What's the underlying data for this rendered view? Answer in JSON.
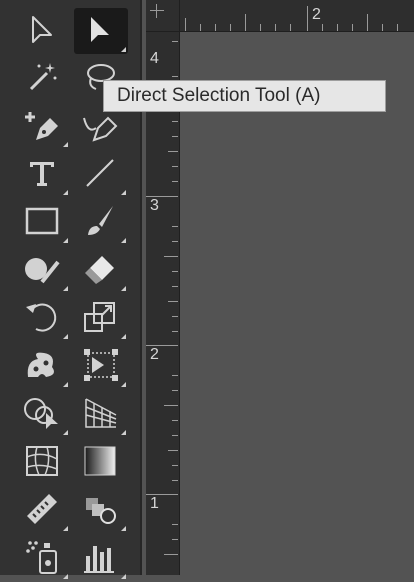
{
  "tooltip": {
    "text": "Direct Selection Tool (A)"
  },
  "ruler": {
    "top_label": "2",
    "left_labels": [
      "4",
      "3",
      "2",
      "1"
    ]
  },
  "colors": {
    "toolbar_bg": "#323232",
    "canvas_bg": "#535353",
    "ruler_bg": "#2e2e2e",
    "active_tool_bg": "#1a1a1a",
    "icon_color": "#d2d2d2",
    "tooltip_bg": "#e6e6e6"
  },
  "tools": [
    {
      "name": "selection-tool",
      "icon": "arrow-outline-icon"
    },
    {
      "name": "direct-selection-tool",
      "icon": "arrow-solid-icon",
      "active": true
    },
    {
      "name": "magic-wand-tool",
      "icon": "magic-wand-icon"
    },
    {
      "name": "lasso-tool",
      "icon": "lasso-icon"
    },
    {
      "name": "pen-tool",
      "icon": "pen-add-icon"
    },
    {
      "name": "curvature-tool",
      "icon": "curvature-pen-icon"
    },
    {
      "name": "type-tool",
      "icon": "type-icon"
    },
    {
      "name": "line-segment-tool",
      "icon": "line-icon"
    },
    {
      "name": "rectangle-tool",
      "icon": "rectangle-icon"
    },
    {
      "name": "paintbrush-tool",
      "icon": "brush-icon"
    },
    {
      "name": "shaper-tool",
      "icon": "shaper-icon"
    },
    {
      "name": "eraser-tool",
      "icon": "eraser-icon"
    },
    {
      "name": "rotate-tool",
      "icon": "rotate-icon"
    },
    {
      "name": "scale-tool",
      "icon": "scale-icon"
    },
    {
      "name": "puppet-warp-tool",
      "icon": "puppet-warp-icon"
    },
    {
      "name": "free-transform-tool",
      "icon": "free-transform-icon"
    },
    {
      "name": "shape-builder-tool",
      "icon": "shape-builder-icon"
    },
    {
      "name": "perspective-grid-tool",
      "icon": "perspective-grid-icon"
    },
    {
      "name": "mesh-tool",
      "icon": "mesh-icon"
    },
    {
      "name": "gradient-tool",
      "icon": "gradient-icon"
    },
    {
      "name": "measure-tool",
      "icon": "ruler-icon"
    },
    {
      "name": "blend-tool",
      "icon": "blend-icon"
    },
    {
      "name": "symbol-sprayer-tool",
      "icon": "symbol-sprayer-icon"
    },
    {
      "name": "column-graph-tool",
      "icon": "bar-graph-icon"
    }
  ]
}
